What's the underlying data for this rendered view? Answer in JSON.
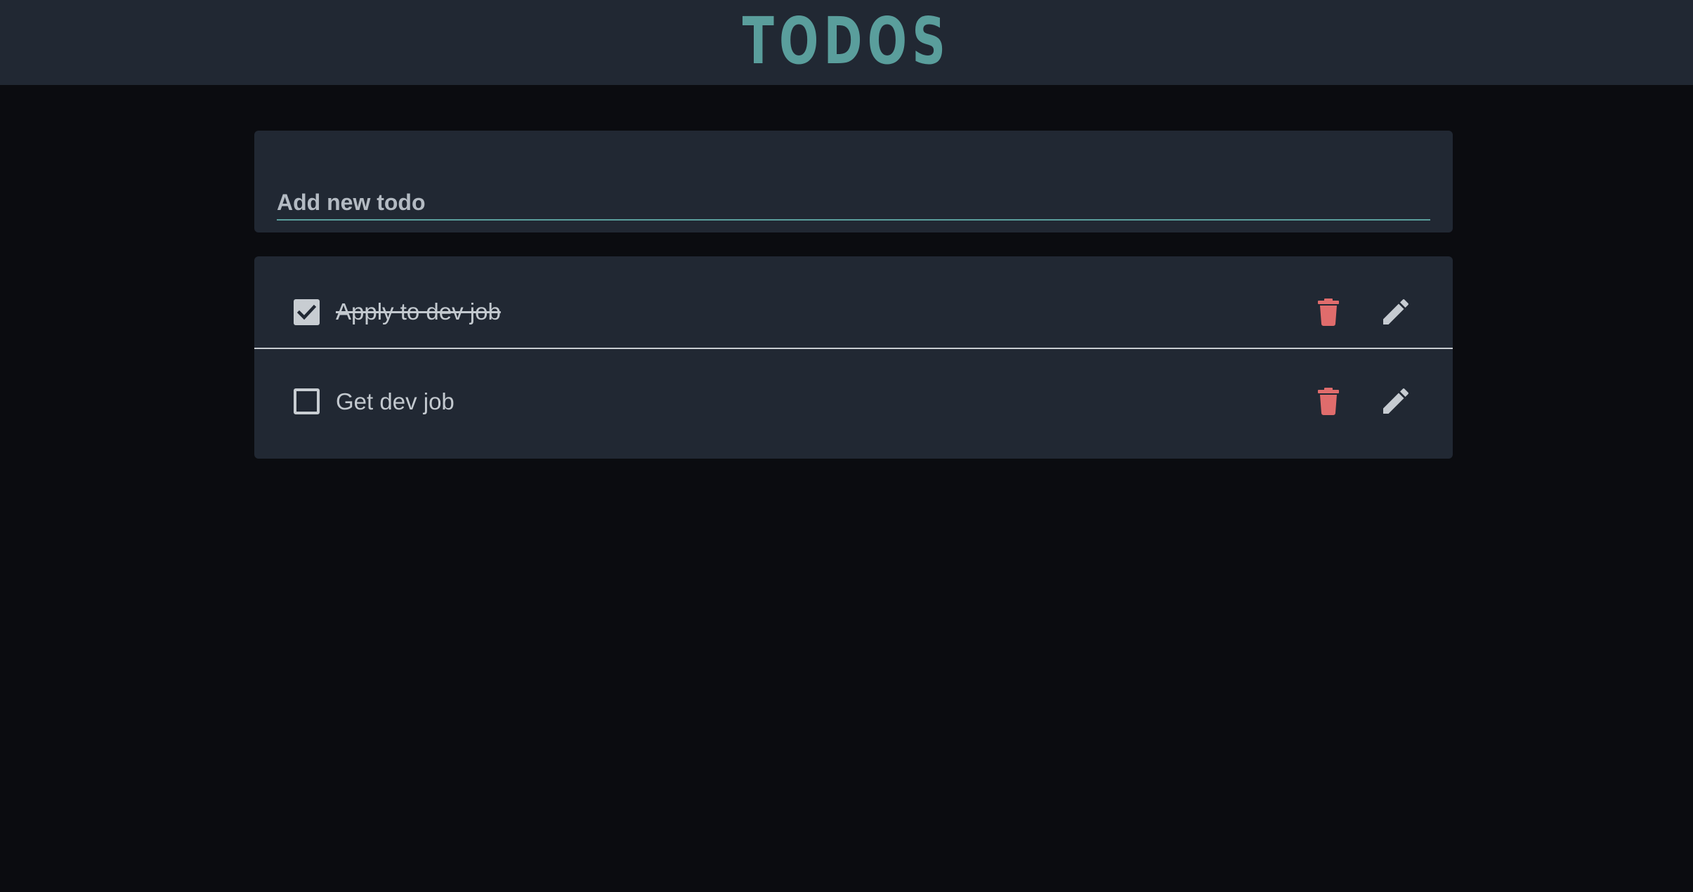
{
  "header": {
    "title": "TODOS"
  },
  "add_form": {
    "placeholder": "Add new todo",
    "value": ""
  },
  "todos": [
    {
      "label": "Apply to dev job",
      "completed": true
    },
    {
      "label": "Get dev job",
      "completed": false
    }
  ],
  "icons": {
    "delete": "trash-icon",
    "edit": "pencil-icon",
    "check": "check-icon"
  },
  "colors": {
    "accent": "#5a9e9c",
    "delete": "#e06c6c",
    "surface": "#212833",
    "background": "#0b0c10"
  }
}
